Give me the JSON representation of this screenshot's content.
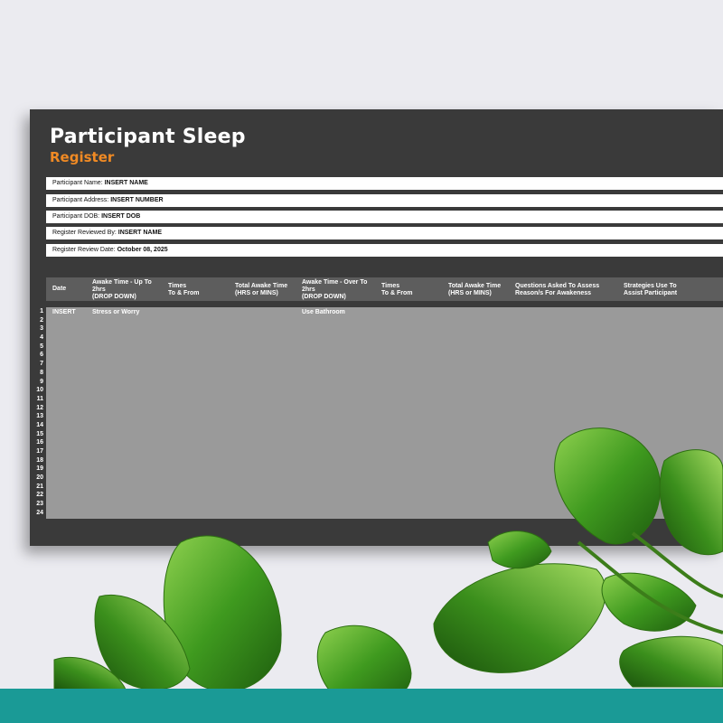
{
  "sheet": {
    "title": "Participant Sleep",
    "subtitle": "Register",
    "info": [
      {
        "label": "Participant Name: ",
        "value": "INSERT NAME"
      },
      {
        "label": "Participant Address: ",
        "value": "INSERT NUMBER"
      },
      {
        "label": "Participant DOB: ",
        "value": "INSERT DOB"
      },
      {
        "label": "Register Reviewed By: ",
        "value": "INSERT NAME"
      },
      {
        "label": "Register Review Date: ",
        "value": "October 08, 2025"
      }
    ],
    "columns": [
      "Date",
      "Awake Time - Up To\n2hrs\n(DROP DOWN)",
      "Times\nTo & From",
      "Total Awake Time\n(HRS or MINS)",
      "Awake Time - Over To\n2hrs\n(DROP DOWN)",
      "Times\nTo & From",
      "Total Awake Time\n(HRS or MINS)",
      "Questions Asked To Assess\nReason/s For Awakeness",
      "Strategies Use To\nAssist Participant"
    ],
    "row_numbers": [
      "1",
      "2",
      "3",
      "4",
      "5",
      "6",
      "7",
      "8",
      "9",
      "10",
      "11",
      "12",
      "13",
      "14",
      "15",
      "16",
      "17",
      "18",
      "19",
      "20",
      "21",
      "22",
      "23",
      "24"
    ],
    "first_row": {
      "date": "INSERT",
      "awake_up_to_2hrs": "Stress or Worry",
      "awake_over_2hrs": "Use Bathroom"
    }
  },
  "colors": {
    "sheet_bg": "#3a3a3a",
    "header_bg": "#5d5d5d",
    "body_bg": "#9a9a9a",
    "accent": "#f08a24",
    "page_bg": "#ebebf0",
    "footer_band": "#1a9a96"
  },
  "decoration": {
    "plant": "green-leaves"
  }
}
